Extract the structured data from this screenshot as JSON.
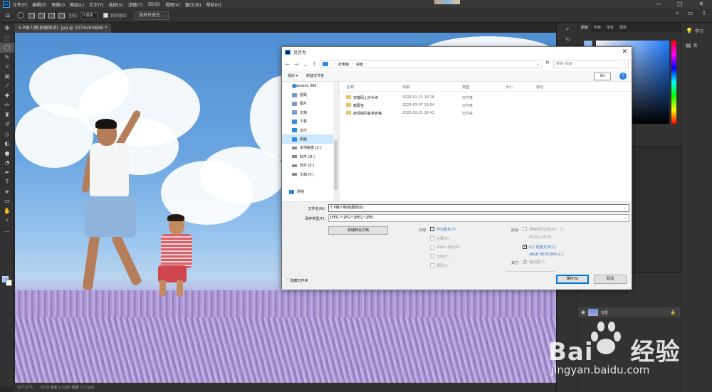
{
  "menubar": {
    "items": [
      "文件(F)",
      "编辑(E)",
      "图像(I)",
      "图层(L)",
      "文字(Y)",
      "选择(S)",
      "滤镜(T)",
      "3D(D)",
      "视图(V)",
      "窗口(W)",
      "帮助(H)"
    ],
    "window_controls": [
      "—",
      "□",
      "✕"
    ]
  },
  "optionsbar": {
    "feather_label": "羽化:",
    "feather_value": "0 像素",
    "antialias_label": "消除锯齿",
    "select_subject_label": "选择并遮住..."
  },
  "document": {
    "tab_title": "5.P婊人物(拓展知识) .jpg @ 107%(RGB/8) *",
    "zoom": "107.37%",
    "size_info": "1920 像素 x 1280 像素 (72 ppi)"
  },
  "panels": {
    "color_tabs": [
      "颜色",
      "色板",
      "渐变",
      "图案"
    ],
    "layer_name": "背景",
    "far_right": [
      {
        "icon": "lightbulb-icon",
        "label": "学习"
      },
      {
        "icon": "library-icon",
        "label": "库"
      }
    ]
  },
  "watermark": {
    "brand": "Bai",
    "brand_cn": "经验",
    "url": "jingyan.baidu.com"
  },
  "dialog": {
    "title": "另存为",
    "close": "✕",
    "address_parts": [
      "此电脑",
      "桌面"
    ],
    "search_placeholder": "搜索\"桌面\"",
    "organize": "组织 ▾",
    "new_folder": "新建文件夹",
    "view_label": "☰▾",
    "help": "?",
    "nav_items": [
      {
        "label": "Autodesk 360",
        "icon": "cloud"
      },
      {
        "label": "视频",
        "icon": "video"
      },
      {
        "label": "图片",
        "icon": "image"
      },
      {
        "label": "文档",
        "icon": "doc"
      },
      {
        "label": "下载",
        "icon": "download"
      },
      {
        "label": "音乐",
        "icon": "music"
      },
      {
        "label": "桌面",
        "icon": "desktop",
        "selected": true
      },
      {
        "label": "本地磁盘 (C:)",
        "icon": "drive"
      },
      {
        "label": "软件 (D:)",
        "icon": "drive"
      },
      {
        "label": "软件 (E:)",
        "icon": "drive"
      },
      {
        "label": "文档 (F:)",
        "icon": "drive"
      },
      {
        "label": "",
        "icon": "none"
      },
      {
        "label": "网络",
        "icon": "network"
      }
    ],
    "columns": [
      "名称",
      "日期",
      "类型",
      "大小",
      "标记"
    ],
    "files": [
      {
        "name": "安徽网上办手续",
        "date": "2020-02-21 18:18",
        "type": "文件夹"
      },
      {
        "name": "截图包",
        "date": "2020-03-07 19:54",
        "type": "文件夹"
      },
      {
        "name": "疫情期间各类表格",
        "date": "2020-02-21 16:42",
        "type": "文件夹"
      }
    ],
    "filename_label": "文件名(N):",
    "filename_value": "5.P婊人物(拓展知识)",
    "filetype_label": "保存类型(T):",
    "filetype_value": "JPEG (*.JPG;*.JPEG;*.JPE)",
    "cloud_button": "存储到云文档",
    "save_group_label": "存储:",
    "save_options": [
      {
        "label": "作为副本(Y)",
        "enabled": true,
        "checked": false,
        "blue": true
      },
      {
        "label": "注释(N)",
        "enabled": false,
        "checked": false
      },
      {
        "label": "Alpha 通道(E)",
        "enabled": false,
        "checked": false
      },
      {
        "label": "专色(P)",
        "enabled": false,
        "checked": false
      },
      {
        "label": "图层(L)",
        "enabled": false,
        "checked": false
      }
    ],
    "color_group_label": "颜色:",
    "color_options": {
      "proof_label": "使用校样设置(O):",
      "proof_value_1": "工",
      "proof_value_2": "作中的 CMYK",
      "icc_label": "ICC 配置文件(C):",
      "icc_value": "sRGB IEC61966-2.1"
    },
    "other_group_label": "其它:",
    "thumbnail_label": "缩览图(T)",
    "hide_folders": "隐藏文件夹",
    "save_button": "保存(S)",
    "cancel_button": "取消"
  }
}
